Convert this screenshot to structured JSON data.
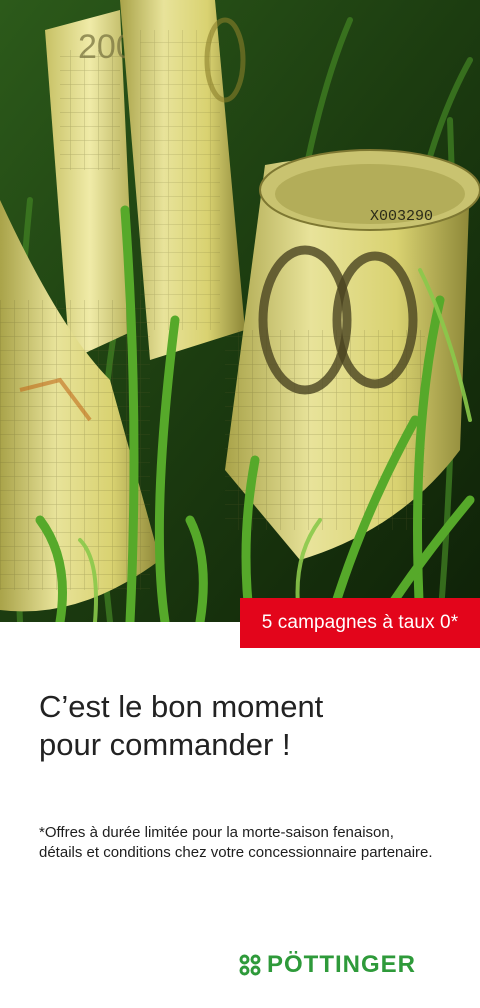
{
  "hero": {
    "image": "banknotes-in-grass"
  },
  "badge": {
    "text": "5 campagnes à taux 0*"
  },
  "headline": {
    "line1": "C’est le bon moment",
    "line2": "pour commander !"
  },
  "footnote": {
    "text": "*Offres à durée limitée pour la morte-saison fenaison, détails et conditions chez votre concessionnaire partenaire."
  },
  "brand": {
    "name": "PÖTTINGER",
    "logo_icon": "poettinger-clover-icon",
    "color": "#2e9a3a"
  },
  "colors": {
    "accent": "#e3051b",
    "text": "#222222"
  }
}
